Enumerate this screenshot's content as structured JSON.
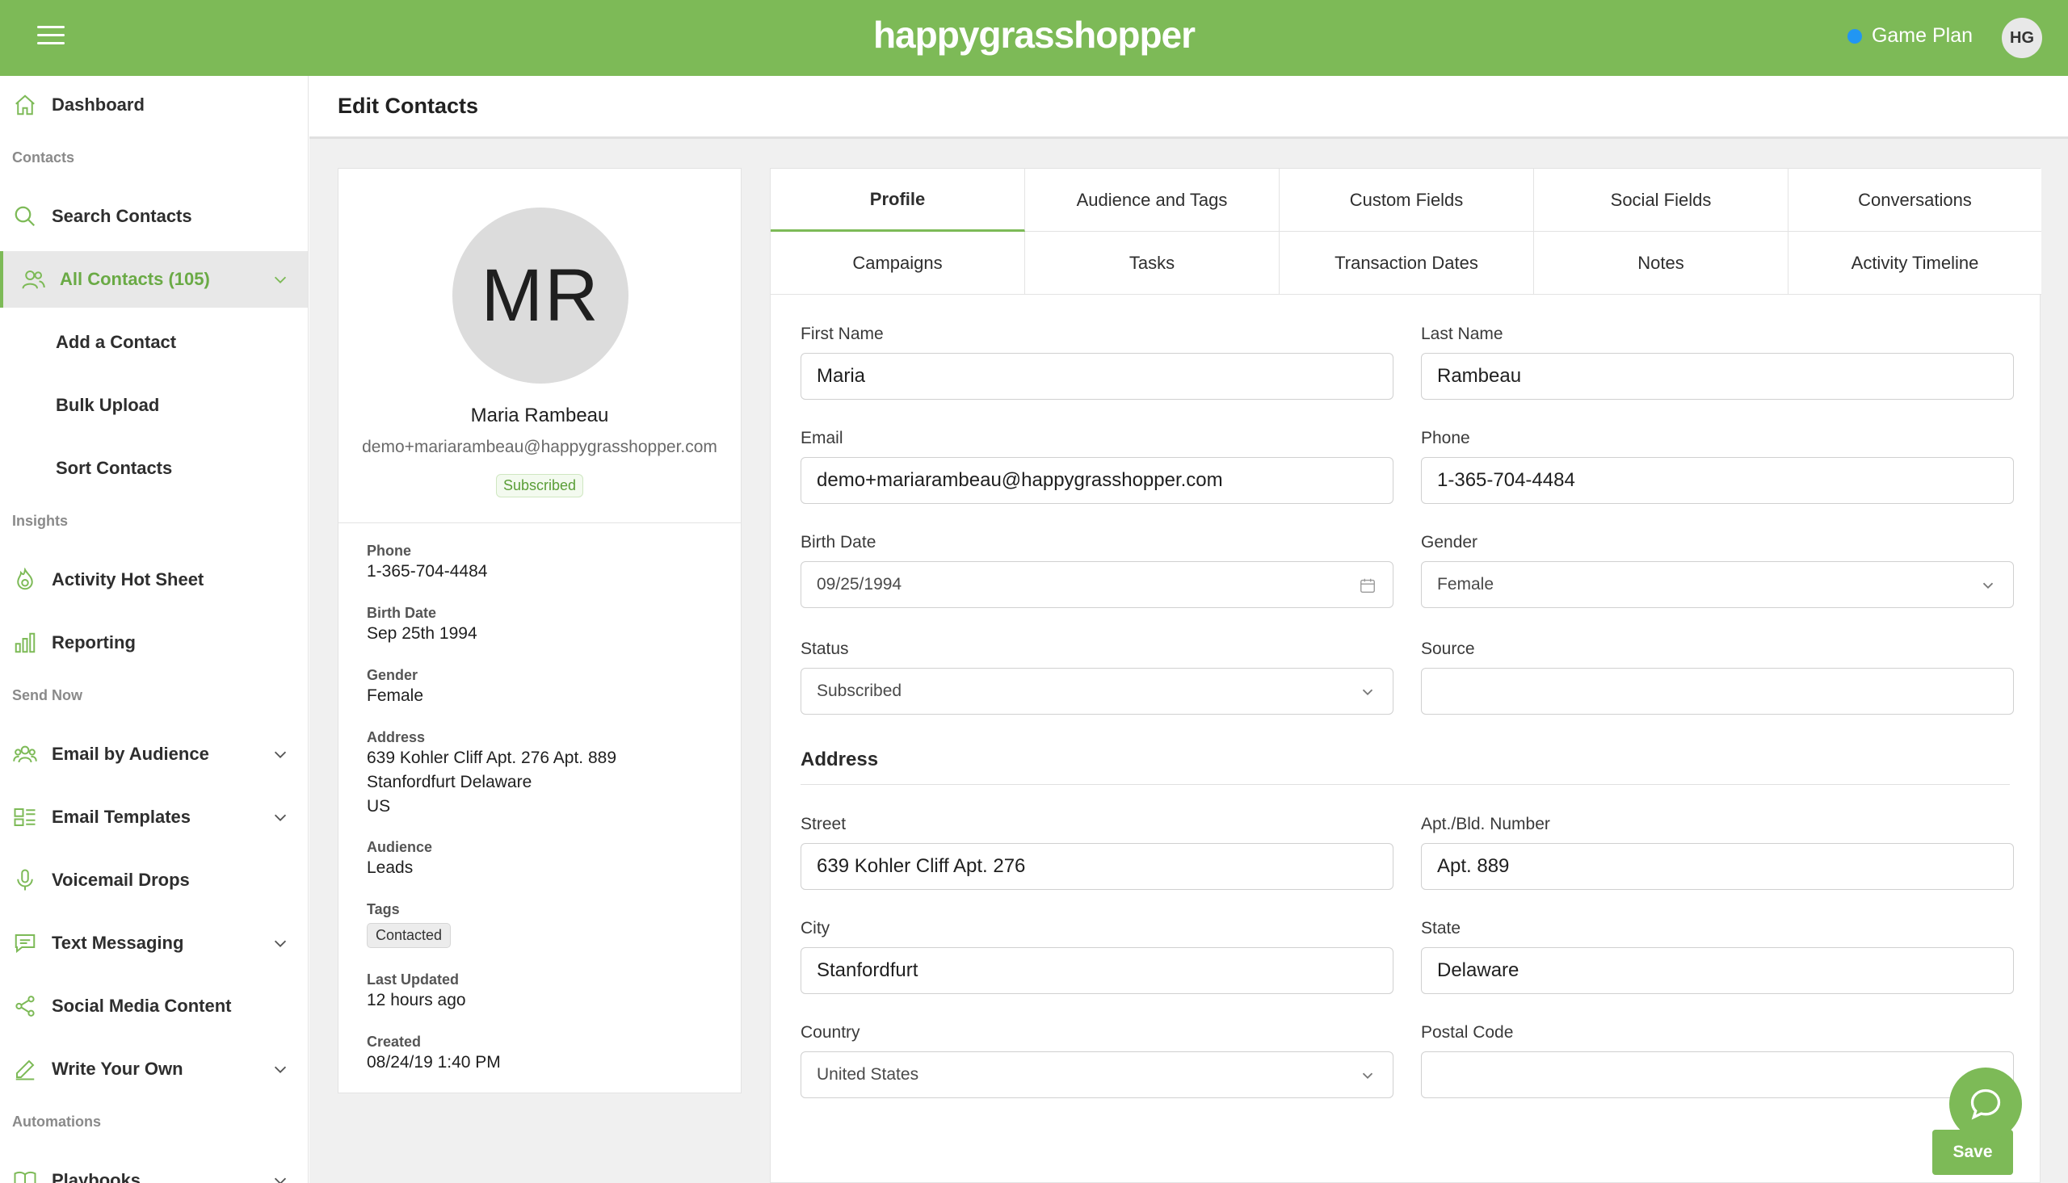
{
  "topbar": {
    "brand": "happygrasshopper",
    "game_plan_label": "Game Plan",
    "user_initials": "HG",
    "status_color": "#2196f3",
    "brand_color": "#7dba57"
  },
  "sidebar": {
    "dashboard": "Dashboard",
    "section_contacts": "Contacts",
    "search_contacts": "Search Contacts",
    "all_contacts": "All Contacts (105)",
    "add_contact": "Add a Contact",
    "bulk_upload": "Bulk Upload",
    "sort_contacts": "Sort Contacts",
    "section_insights": "Insights",
    "activity_hot_sheet": "Activity Hot Sheet",
    "reporting": "Reporting",
    "section_send_now": "Send Now",
    "email_by_audience": "Email by Audience",
    "email_templates": "Email Templates",
    "voicemail_drops": "Voicemail Drops",
    "text_messaging": "Text Messaging",
    "social_media_content": "Social Media Content",
    "write_your_own": "Write Your Own",
    "section_automations": "Automations",
    "playbooks": "Playbooks"
  },
  "page": {
    "title": "Edit Contacts"
  },
  "profile": {
    "initials": "MR",
    "name": "Maria Rambeau",
    "email": "demo+mariarambeau@happygrasshopper.com",
    "status_badge": "Subscribed",
    "details": {
      "phone_label": "Phone",
      "phone": "1-365-704-4484",
      "birth_label": "Birth Date",
      "birth": "Sep 25th 1994",
      "gender_label": "Gender",
      "gender": "Female",
      "address_label": "Address",
      "address_line1": "639 Kohler Cliff Apt. 276 Apt. 889",
      "address_line2": "Stanfordfurt Delaware",
      "address_line3": "US",
      "audience_label": "Audience",
      "audience": "Leads",
      "tags_label": "Tags",
      "tag1": "Contacted",
      "updated_label": "Last Updated",
      "updated": "12 hours ago",
      "created_label": "Created",
      "created": "08/24/19 1:40 PM"
    }
  },
  "tabs": {
    "profile": "Profile",
    "audience_tags": "Audience and Tags",
    "custom_fields": "Custom Fields",
    "social_fields": "Social Fields",
    "conversations": "Conversations",
    "campaigns": "Campaigns",
    "tasks": "Tasks",
    "transaction_dates": "Transaction Dates",
    "notes": "Notes",
    "activity_timeline": "Activity Timeline"
  },
  "form": {
    "first_name_label": "First Name",
    "first_name": "Maria",
    "last_name_label": "Last Name",
    "last_name": "Rambeau",
    "email_label": "Email",
    "email": "demo+mariarambeau@happygrasshopper.com",
    "phone_label": "Phone",
    "phone": "1-365-704-4484",
    "birth_label": "Birth Date",
    "birth": "09/25/1994",
    "gender_label": "Gender",
    "gender": "Female",
    "status_label": "Status",
    "status": "Subscribed",
    "source_label": "Source",
    "source": "",
    "address_title": "Address",
    "street_label": "Street",
    "street": "639 Kohler Cliff Apt. 276",
    "apt_label": "Apt./Bld. Number",
    "apt": "Apt. 889",
    "city_label": "City",
    "city": "Stanfordfurt",
    "state_label": "State",
    "state": "Delaware",
    "country_label": "Country",
    "country": "United States",
    "postal_label": "Postal Code",
    "postal": "",
    "save": "Save"
  }
}
